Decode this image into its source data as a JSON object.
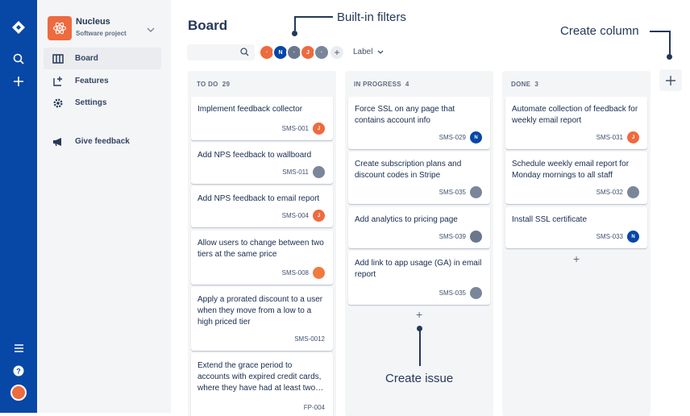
{
  "project": {
    "name": "Nucleus",
    "type": "Software project"
  },
  "nav": [
    "Board",
    "Features",
    "Settings",
    "Give feedback"
  ],
  "board": {
    "title": "Board",
    "label_filter": "Label"
  },
  "callouts": {
    "filters": "Built-in filters",
    "create_column": "Create column",
    "create_issue": "Create issue"
  },
  "avatars": [
    {
      "color": "#ee6a3f",
      "glyph": "·"
    },
    {
      "color": "#0747a6",
      "glyph": "N"
    },
    {
      "color": "#6b778c",
      "glyph": "·"
    },
    {
      "color": "#ee6a3f",
      "glyph": "J"
    },
    {
      "color": "#7a869a",
      "glyph": "·"
    }
  ],
  "columns": [
    {
      "name": "TO DO",
      "count": "29",
      "cards": [
        {
          "title": "Implement feedback collector",
          "key": "SMS-001",
          "av": "#ee6a3f",
          "g": "J"
        },
        {
          "title": "Add NPS feedback to wallboard",
          "key": "SMS-011",
          "av": "#7a869a",
          "g": ""
        },
        {
          "title": "Add NPS feedback to email report",
          "key": "SMS-004",
          "av": "#ee6a3f",
          "g": "J"
        },
        {
          "title": "Allow users to change between two tiers at the same price",
          "key": "SMS-008",
          "av": "#f07b3f",
          "g": ""
        },
        {
          "title": "Apply a prorated discount to a user when they move from a low to a high priced tier",
          "key": "SMS-0012",
          "av": "",
          "g": ""
        },
        {
          "title": "Extend the grace period to accounts with expired credit cards, where they have had at least two…",
          "key": "FP-004",
          "av": "",
          "g": ""
        }
      ]
    },
    {
      "name": "IN PROGRESS",
      "count": "4",
      "cards": [
        {
          "title": "Force SSL on any page that contains account info",
          "key": "SMS-029",
          "av": "#0747a6",
          "g": "N"
        },
        {
          "title": "Create subscription plans and discount codes in Stripe",
          "key": "SMS-035",
          "av": "#7a869a",
          "g": ""
        },
        {
          "title": "Add analytics to pricing page",
          "key": "SMS-039",
          "av": "#6b778c",
          "g": ""
        },
        {
          "title": "Add link to app usage (GA) in email report",
          "key": "SMS-035",
          "av": "#7a869a",
          "g": ""
        }
      ]
    },
    {
      "name": "DONE",
      "count": "3",
      "cards": [
        {
          "title": "Automate collection of feedback for weekly email report",
          "key": "SMS-031",
          "av": "#ee6a3f",
          "g": "J"
        },
        {
          "title": "Schedule weekly email report for Monday mornings to all staff",
          "key": "SMS-032",
          "av": "#7a869a",
          "g": ""
        },
        {
          "title": "Install SSL certificate",
          "key": "SMS-033",
          "av": "#0747a6",
          "g": "N"
        }
      ]
    }
  ]
}
